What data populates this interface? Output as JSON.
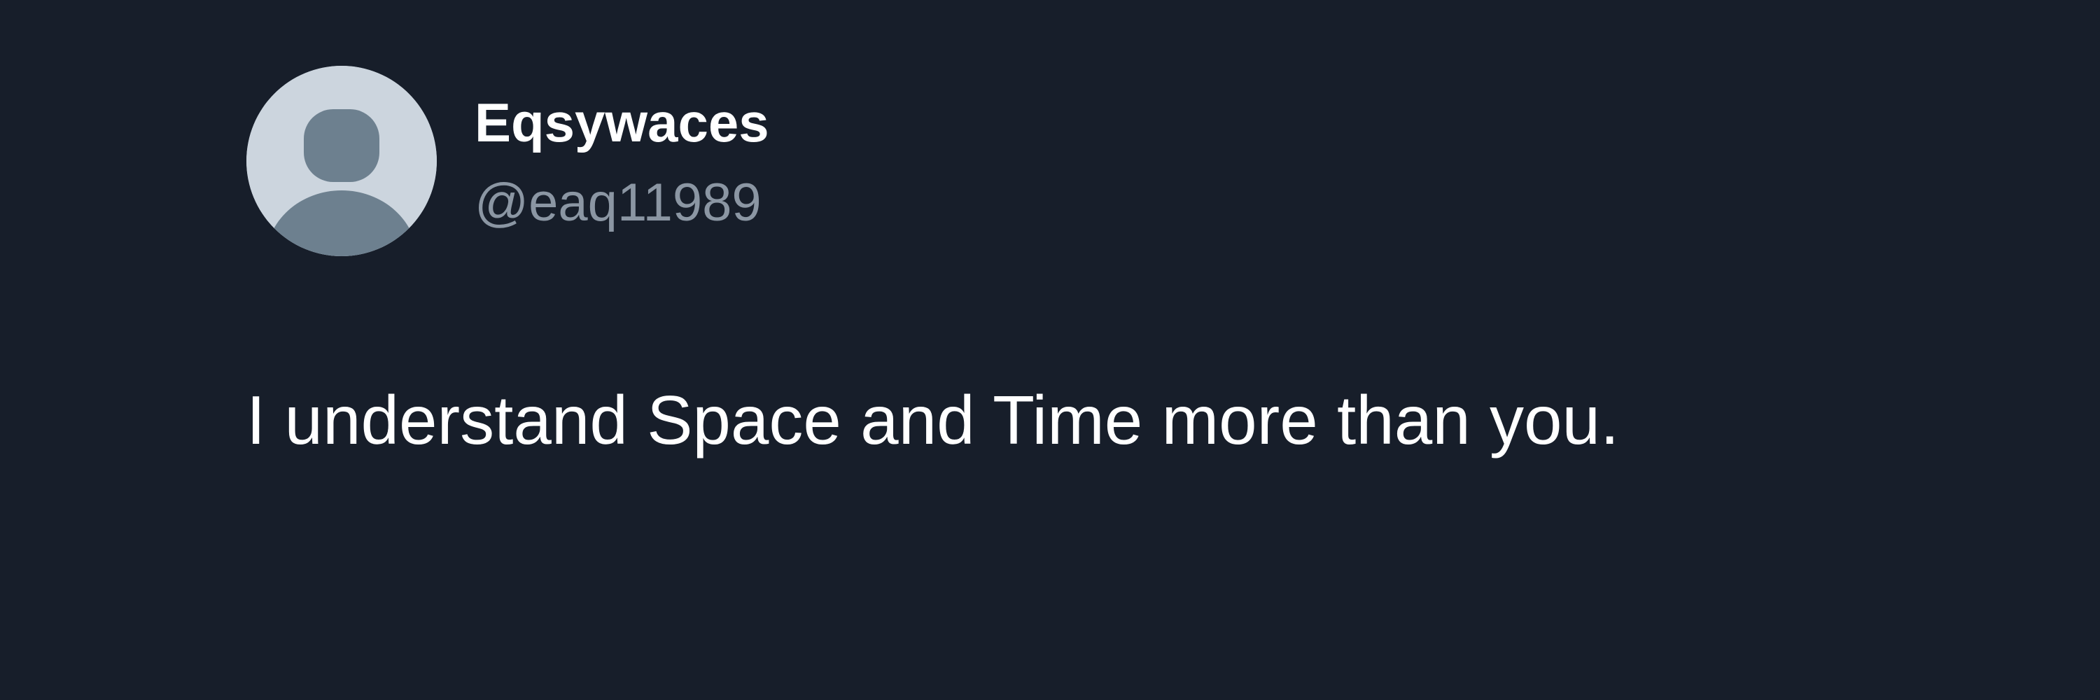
{
  "tweet": {
    "author": {
      "display_name": "Eqsywaces",
      "handle": "@eaq11989",
      "avatar_icon": "default-profile-icon"
    },
    "text": "I understand Space and Time more than you."
  },
  "colors": {
    "background": "#171e2a",
    "avatar_background": "#ccd5de",
    "avatar_silhouette": "#6d808f",
    "primary_text": "#ffffff",
    "secondary_text": "#8b96a3"
  }
}
